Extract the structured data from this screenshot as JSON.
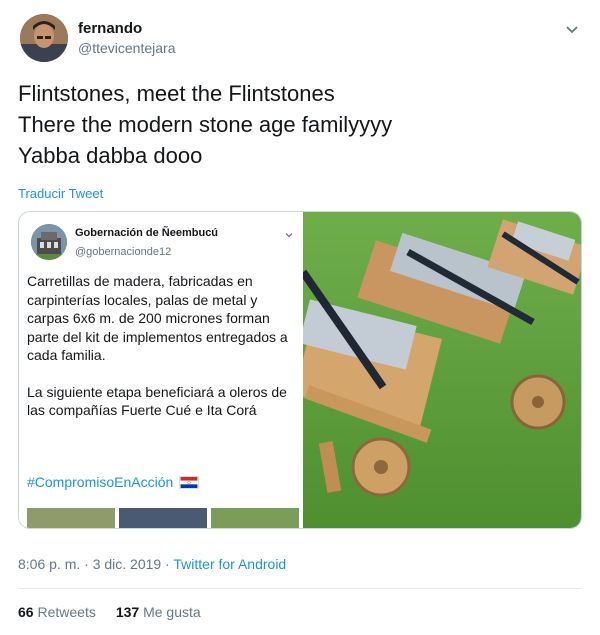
{
  "author": {
    "name": "fernando",
    "handle": "@ttevicentejara"
  },
  "tweet": {
    "lines": [
      "Flintstones, meet the Flintstones",
      "There the modern stone age familyyyy",
      "Yabba dabba dooo"
    ],
    "translate_label": "Traducir Tweet"
  },
  "quoted": {
    "name": "Gobernación de Ñeembucú",
    "handle": "@gobernacionde12",
    "paragraph1": "Carretillas de madera, fabricadas en carpinterías locales, palas de metal y carpas 6x6 m. de 200 micrones forman parte del kit de implementos entregados a cada familia.",
    "paragraph2": "La siguiente etapa beneficiará a oleros de las compañías Fuerte Cué e Ita Corá",
    "hashtag": "#CompromisoEnAcción",
    "flag_colors": [
      "#d52b1e",
      "#ffffff",
      "#0038a8"
    ]
  },
  "meta": {
    "time": "8:06 p. m. · 3 dic. 2019 · ",
    "source": "Twitter for Android"
  },
  "stats": {
    "retweets_count": "66",
    "retweets_label": "Retweets",
    "likes_count": "137",
    "likes_label": "Me gusta"
  },
  "icons": {
    "caret": "chevron-down-icon",
    "flag": "paraguay-flag-icon"
  }
}
